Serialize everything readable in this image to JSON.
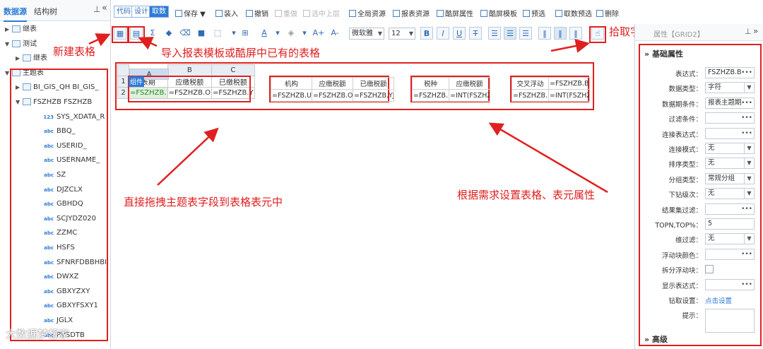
{
  "left_panel": {
    "tabs": [
      "数据源",
      "结构树"
    ],
    "pin_icon": "pin-icon",
    "collapse_icon": "double-chevron-left-icon",
    "tree": [
      {
        "label": "继表",
        "level": 0,
        "arrow": "▶",
        "icon": "table"
      },
      {
        "label": "测试",
        "level": 0,
        "arrow": "▼",
        "icon": "folder"
      },
      {
        "label": "继表",
        "level": 1,
        "arrow": "▶",
        "icon": "table"
      },
      {
        "label": "主题表",
        "level": 0,
        "arrow": "▼",
        "icon": "folder"
      },
      {
        "label": "BI_GIS_QH BI_GIS_",
        "level": 1,
        "arrow": "▶",
        "icon": "table"
      },
      {
        "label": "FSZHZB FSZHZB",
        "level": 1,
        "arrow": "▼",
        "icon": "table"
      },
      {
        "label": "SYS_XDATA_R",
        "level": 2,
        "badge": "123"
      },
      {
        "label": "BBQ_",
        "level": 2,
        "badge": "abc"
      },
      {
        "label": "USERID_",
        "level": 2,
        "badge": "abc"
      },
      {
        "label": "USERNAME_",
        "level": 2,
        "badge": "abc"
      },
      {
        "label": "SZ",
        "level": 2,
        "badge": "abc"
      },
      {
        "label": "DJZCLX",
        "level": 2,
        "badge": "abc"
      },
      {
        "label": "GBHDQ",
        "level": 2,
        "badge": "abc"
      },
      {
        "label": "SCJYDZ020",
        "level": 2,
        "badge": "abc"
      },
      {
        "label": "ZZMC",
        "level": 2,
        "badge": "abc"
      },
      {
        "label": "HSFS",
        "level": 2,
        "badge": "abc"
      },
      {
        "label": "SFNRFDBBHBF",
        "level": 2,
        "badge": "abc"
      },
      {
        "label": "DWXZ",
        "level": 2,
        "badge": "abc"
      },
      {
        "label": "GBXYZXY",
        "level": 2,
        "badge": "abc"
      },
      {
        "label": "GBXYFSXY1",
        "level": 2,
        "badge": "abc"
      },
      {
        "label": "JGLX",
        "level": 2,
        "badge": "abc"
      },
      {
        "label": "PVSDTB",
        "level": 2,
        "badge": "abc"
      }
    ],
    "watermark": "大数据梦想家"
  },
  "toolbar1": {
    "modes": [
      "代码",
      "设计",
      "取数"
    ],
    "items": [
      {
        "label": "保存 ▼",
        "disabled": false
      },
      {
        "label": "装入",
        "disabled": false
      },
      {
        "label": "撤销",
        "disabled": false
      },
      {
        "label": "重做",
        "disabled": true
      },
      {
        "label": "选中上层",
        "disabled": true
      },
      {
        "label": "全局资源",
        "disabled": false
      },
      {
        "label": "报表资源",
        "disabled": false
      },
      {
        "label": "酷屏属性",
        "disabled": false
      },
      {
        "label": "酷屏模板",
        "disabled": false
      },
      {
        "label": "预选",
        "disabled": false
      },
      {
        "label": "取数预选",
        "disabled": false
      },
      {
        "label": "删除",
        "disabled": false
      }
    ]
  },
  "toolbar2": {
    "font_family": "微软雅",
    "font_size": "12",
    "icons": [
      "new-table-icon",
      "import-table-icon",
      "sum-icon",
      "brush-icon",
      "eraser-icon",
      "fill-icon",
      "resize-icon",
      "merge-icon",
      "font-color-icon",
      "bg-color-icon",
      "font-grow-icon",
      "font-shrink-icon",
      "bold-icon",
      "italic-icon",
      "underline-icon",
      "strikethrough-icon",
      "align-left-icon",
      "align-center-icon",
      "align-right-icon",
      "valign-top-icon",
      "valign-middle-icon",
      "valign-bottom-icon",
      "pick-field-icon"
    ],
    "glyphs": {
      "sum": "Σ",
      "bold": "B",
      "italic": "I",
      "underline": "U",
      "strike": "T",
      "grow": "A+",
      "shrink": "A-",
      "font_color": "A"
    }
  },
  "grid": {
    "col_headers": [
      "A",
      "B",
      "C"
    ],
    "row_headers": [
      "1",
      "2"
    ],
    "badge": "组件",
    "table1": [
      [
        "表期",
        "应缴税额",
        "已缴税额"
      ],
      [
        "=FSZHZB.",
        "=FSZHZB.O",
        "=FSZHZB.Y"
      ]
    ],
    "table2": [
      [
        "机构",
        "应缴税额",
        "已缴税额"
      ],
      [
        "=FSZHZB.U",
        "=FSZHZB.O",
        "=FSZHZB.YJ"
      ]
    ],
    "table3": [
      [
        "税种",
        "应缴税额"
      ],
      [
        "=FSZHZB.",
        "=INT(FSZHZ"
      ]
    ],
    "table4": [
      [
        "交叉浮动",
        "=FSZHZB.B"
      ],
      [
        "=FSZHZB.",
        "=INT(FSZHZ"
      ]
    ]
  },
  "annotations": {
    "new_table": "新建表格",
    "import": "导入报表模板或酷屏中已有的表格",
    "pick": "拾取字段和指标",
    "drag": "直接拖拽主题表字段到表格表元中",
    "set_props": "根据需求设置表格、表元属性"
  },
  "right_panel": {
    "title": "属性【GRID2】",
    "section_basic": "基础属性",
    "section_advanced": "高级",
    "props": [
      {
        "label": "表达式：",
        "value": "FSZHZB.B",
        "control": "dots"
      },
      {
        "label": "数据类型：",
        "value": "字符",
        "control": "dropdown"
      },
      {
        "label": "数据期条件：",
        "value": "报表主题期",
        "control": "dots"
      },
      {
        "label": "过滤条件：",
        "value": "",
        "control": "dots"
      },
      {
        "label": "连接表达式：",
        "value": "",
        "control": "dots"
      },
      {
        "label": "连接模式：",
        "value": "无",
        "control": "dropdown"
      },
      {
        "label": "排序类型：",
        "value": "无",
        "control": "dropdown"
      },
      {
        "label": "分组类型：",
        "value": "常规分组",
        "control": "dropdown"
      },
      {
        "label": "下钻级次：",
        "value": "无",
        "control": "dropdown"
      },
      {
        "label": "结果集过滤：",
        "value": "",
        "control": "dots"
      },
      {
        "label": "TOPN,TOP%：",
        "value": "5",
        "control": "input"
      },
      {
        "label": "维过滤：",
        "value": "无",
        "control": "dropdown"
      },
      {
        "label": "浮动块颜色：",
        "value": "",
        "control": "dots"
      },
      {
        "label": "拆分浮动块：",
        "value": "",
        "control": "checkbox"
      },
      {
        "label": "显示表达式：",
        "value": "",
        "control": "dots"
      },
      {
        "label": "钻取设置：",
        "value": "点击设置",
        "control": "link"
      },
      {
        "label": "提示：",
        "value": "",
        "control": "textarea"
      }
    ]
  },
  "colors": {
    "accent": "#2f7bd6",
    "annotation": "#e02020"
  }
}
